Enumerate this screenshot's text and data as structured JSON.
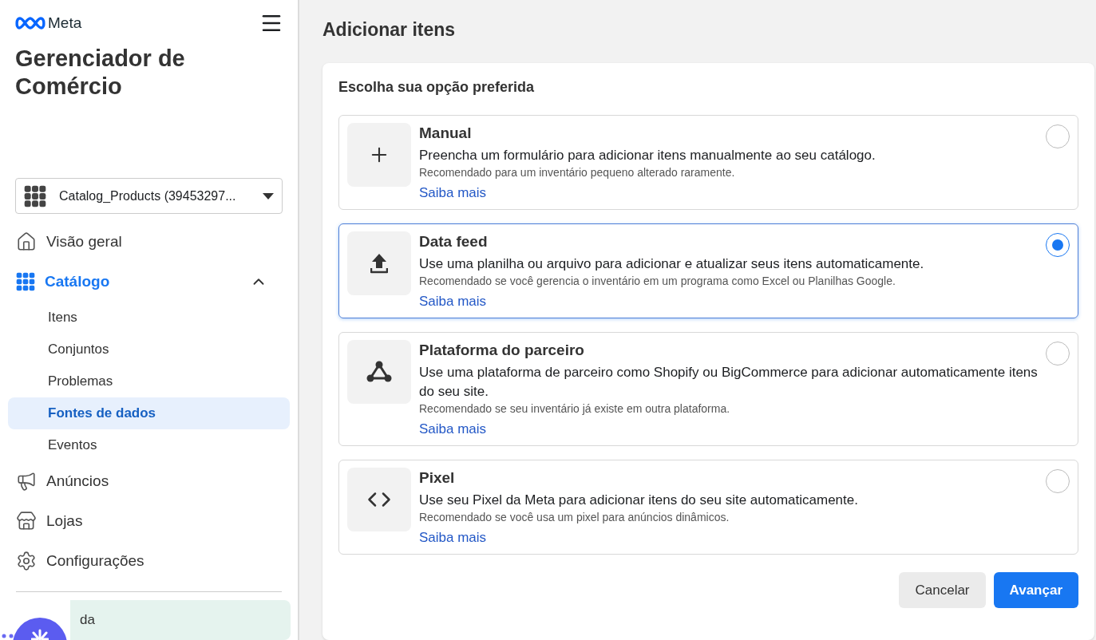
{
  "brand": {
    "name": "Meta"
  },
  "app_title": "Gerenciador de Comércio",
  "catalog_selector": {
    "value": "Catalog_Products (39453297..."
  },
  "nav": [
    {
      "kind": "home",
      "label": "Visão geral",
      "expanded": false
    },
    {
      "kind": "catalog",
      "label": "Catálogo",
      "expanded": true,
      "children": [
        {
          "label": "Itens",
          "selected": false
        },
        {
          "label": "Conjuntos",
          "selected": false
        },
        {
          "label": "Problemas",
          "selected": false
        },
        {
          "label": "Fontes de dados",
          "selected": true
        },
        {
          "label": "Eventos",
          "selected": false
        }
      ]
    },
    {
      "kind": "ads",
      "label": "Anúncios",
      "expanded": false
    },
    {
      "kind": "shops",
      "label": "Lojas",
      "expanded": false
    },
    {
      "kind": "settings",
      "label": "Configurações",
      "expanded": false
    }
  ],
  "help_item": {
    "label": "da"
  },
  "page_title": "Adicionar itens",
  "prompt": "Escolha sua opção preferida",
  "options": [
    {
      "kind": "manual",
      "title": "Manual",
      "description": "Preencha um formulário para adicionar itens manualmente ao seu catálogo.",
      "recommendation": "Recomendado para um inventário pequeno alterado raramente.",
      "link": "Saiba mais",
      "selected": false
    },
    {
      "kind": "feed",
      "title": "Data feed",
      "description": "Use uma planilha ou arquivo para adicionar e atualizar seus itens automaticamente.",
      "recommendation": "Recomendado se você gerencia o inventário em um programa como Excel ou Planilhas Google.",
      "link": "Saiba mais",
      "selected": true
    },
    {
      "kind": "partner",
      "title": "Plataforma do parceiro",
      "description": "Use uma plataforma de parceiro como Shopify ou BigCommerce para adicionar automaticamente itens do seu site.",
      "recommendation": "Recomendado se seu inventário já existe em outra plataforma.",
      "link": "Saiba mais",
      "selected": false
    },
    {
      "kind": "pixel",
      "title": "Pixel",
      "description": "Use seu Pixel da Meta para adicionar itens do seu site automaticamente.",
      "recommendation": "Recomendado se você usa um pixel para anúncios dinâmicos.",
      "link": "Saiba mais",
      "selected": false
    }
  ],
  "buttons": {
    "cancel": "Cancelar",
    "next": "Avançar"
  }
}
